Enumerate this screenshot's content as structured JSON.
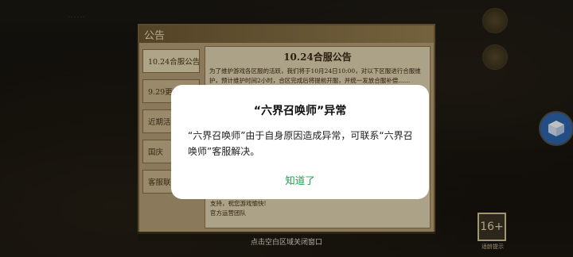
{
  "background": {
    "top_text": "……"
  },
  "notice": {
    "title": "公告",
    "tabs": [
      {
        "label": "10.24合服公告",
        "active": true
      },
      {
        "label": "9.29更新",
        "active": false
      },
      {
        "label": "近期活动",
        "active": false
      },
      {
        "label": "国庆",
        "active": false
      },
      {
        "label": "客服联系",
        "active": false
      }
    ],
    "content_title": "10.24合服公告",
    "content_body": "为了维护游戏各区服的活跃，我们将于10月24日10:00，对以下区服进行合服维护，预计维护时间2小时，合区完成后将提前开服，并统一发放合服补偿……",
    "footer_line1": "支持，祝您游戏愉快!",
    "footer_line2": "官方运营团队",
    "close_hint": "点击空白区域关闭窗口"
  },
  "age_badge": {
    "rating": "16+",
    "label": "适龄提示"
  },
  "float_button": {
    "icon": "cube-icon",
    "color": "#2f67b2"
  },
  "dialog": {
    "title": "“六界召唤师”异常",
    "message": "“六界召唤师”由于自身原因造成异常，可联系“六界召唤师”客服解决。",
    "ok_label": "知道了",
    "ok_color": "#1aa34a"
  }
}
